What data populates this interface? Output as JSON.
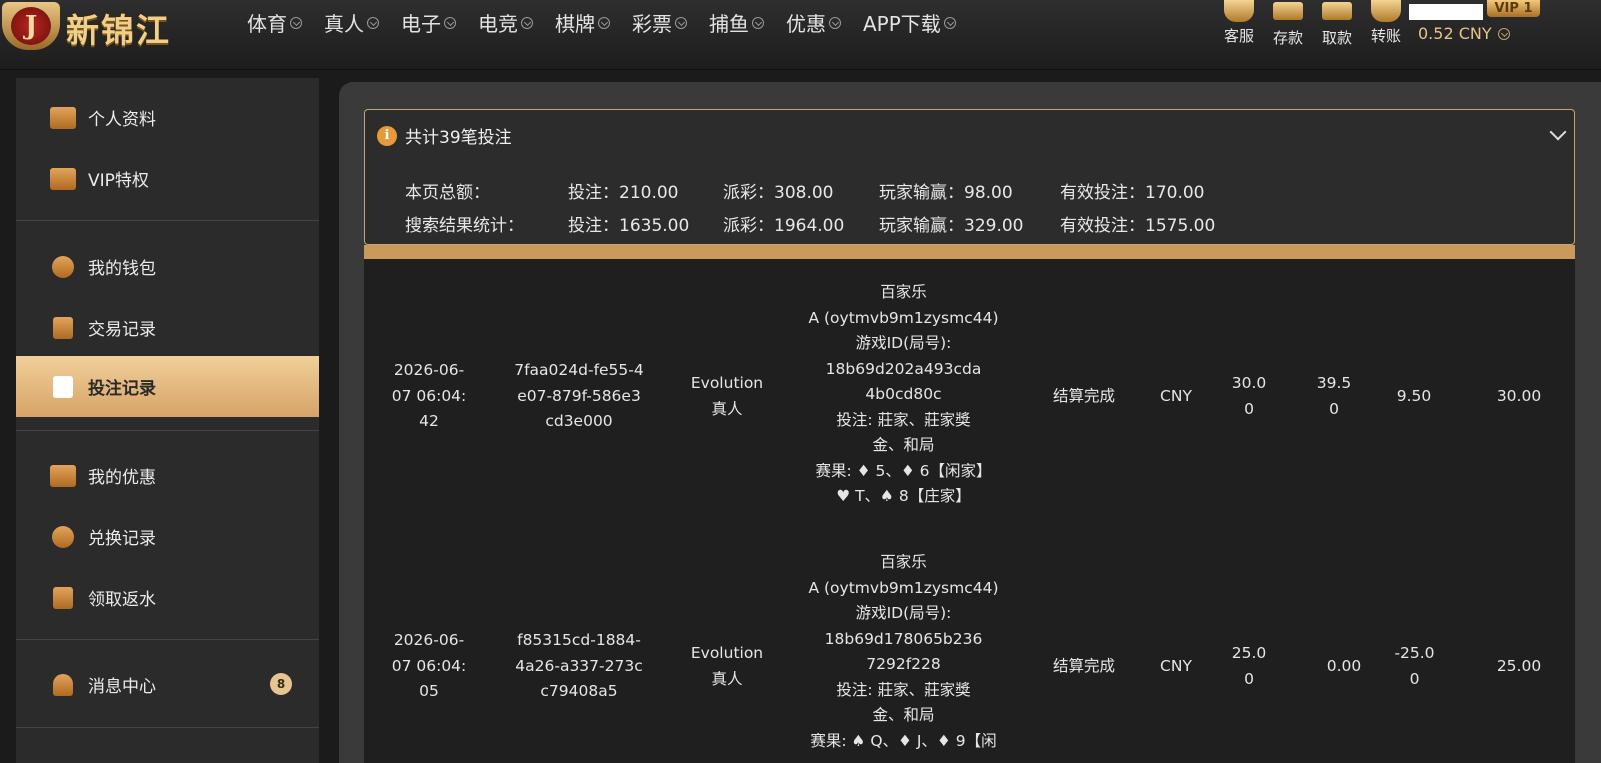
{
  "header": {
    "brand_mark": "J",
    "brand_name": "新锦江",
    "nav": [
      {
        "label": "体育"
      },
      {
        "label": "真人"
      },
      {
        "label": "电子"
      },
      {
        "label": "电竞"
      },
      {
        "label": "棋牌"
      },
      {
        "label": "彩票"
      },
      {
        "label": "捕鱼"
      },
      {
        "label": "优惠"
      },
      {
        "label": "APP下载"
      }
    ],
    "tools": {
      "service": "客服",
      "deposit": "存款",
      "withdraw": "取款",
      "transfer": "转账"
    },
    "balance": "0.52 CNY",
    "vip": "VIP 1"
  },
  "sidebar": {
    "items": [
      {
        "label": "个人资料",
        "icon": "id-card-icon"
      },
      {
        "label": "VIP特权",
        "icon": "vip-card-icon"
      },
      {
        "label": "我的钱包",
        "icon": "piggy-bank-icon"
      },
      {
        "label": "交易记录",
        "icon": "transaction-doc-icon"
      },
      {
        "label": "投注记录",
        "icon": "bet-record-doc-icon"
      },
      {
        "label": "我的优惠",
        "icon": "gift-bag-icon"
      },
      {
        "label": "兑换记录",
        "icon": "money-bag-icon"
      },
      {
        "label": "领取返水",
        "icon": "rebate-doc-icon"
      },
      {
        "label": "消息中心",
        "icon": "bell-icon",
        "badge": "8"
      }
    ],
    "active_index": 4
  },
  "summary": {
    "title": "共计39笔投注",
    "page_label": "本页总额：",
    "page_stake": "投注：210.00",
    "page_payout": "派彩：308.00",
    "page_winloss": "玩家输赢：98.00",
    "page_valid": "有效投注：170.00",
    "search_label": "搜索结果统计：",
    "search_stake": "投注：1635.00",
    "search_payout": "派彩：1964.00",
    "search_winloss": "玩家输赢：329.00",
    "search_valid": "有效投注：1575.00"
  },
  "records": [
    {
      "time": "2026-06-07 06:04:42",
      "order_id": "7faa024d-fe55-4e07-879f-586e3cd3e000",
      "platform": "Evolution 真人",
      "detail_lines": [
        "百家乐",
        "A (oytmvb9m1zysmc44)",
        "游戏ID(局号):",
        "18b69d202a493cda4b0cd80c",
        "投注: 莊家、莊家獎金、和局",
        "赛果: ♦ 5、♦ 6【闲家】",
        "♥ T、♠ 8【庄家】"
      ],
      "status": "结算完成",
      "currency": "CNY",
      "stake": "30.00",
      "payout": "39.50",
      "winloss": "9.50",
      "valid": "30.00"
    },
    {
      "time": "2026-06-07 06:04:05",
      "order_id": "f85315cd-1884-4a26-a337-273cc79408a5",
      "platform": "Evolution 真人",
      "detail_lines": [
        "百家乐",
        "A (oytmvb9m1zysmc44)",
        "游戏ID(局号):",
        "18b69d178065b2367292f228",
        "投注: 莊家、莊家獎金、和局",
        "赛果: ♠ Q、♦ J、♦ 9【闲"
      ],
      "status": "结算完成",
      "currency": "CNY",
      "stake": "25.00",
      "payout": "0.00",
      "winloss": "-25.00",
      "valid": "25.00"
    }
  ],
  "colors": {
    "accent_gold": "#d6a367",
    "summary_border": "#c8a56e",
    "info_orange": "#e79a3a"
  }
}
